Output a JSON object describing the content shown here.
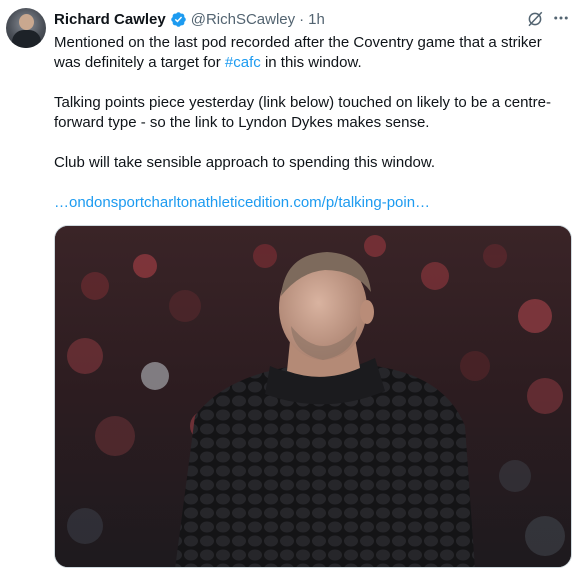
{
  "author": {
    "name": "Richard Cawley",
    "handle": "@RichSCawley",
    "separator": "·",
    "time": "1h"
  },
  "tweet": {
    "para1_pre": "Mentioned on the last pod recorded after the Coventry game that a striker was definitely a target for ",
    "hashtag": "#cafc",
    "para1_post": " in this window.",
    "para2": "Talking points piece yesterday (link below) touched on likely to be a centre-forward type - so the link to Lyndon Dykes makes sense.",
    "para3": "Club will take sensible approach to spending this window.",
    "link": "…ondonsportcharltonathleticedition.com/p/talking-poin…"
  },
  "icons": {
    "avatar": "profile-photo",
    "verified": "verified-badge-icon",
    "grok": "grok-icon",
    "more": "more-options-icon"
  },
  "colors": {
    "accent": "#1d9bf0",
    "text": "#0f1419",
    "secondary": "#536471"
  }
}
